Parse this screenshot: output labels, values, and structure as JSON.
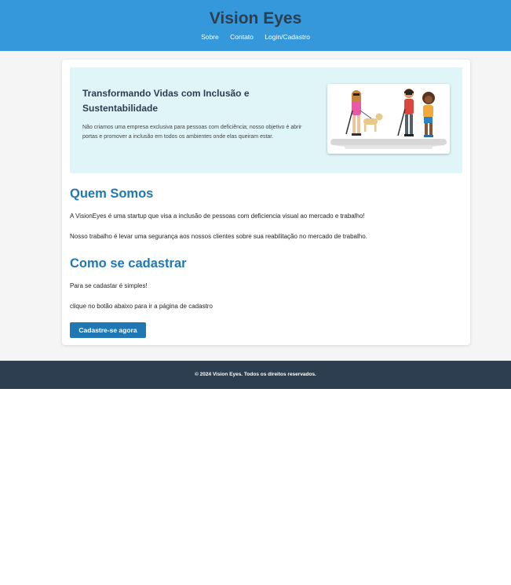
{
  "header": {
    "title": "Vision Eyes",
    "nav": [
      {
        "label": "Sobre"
      },
      {
        "label": "Contato"
      },
      {
        "label": "Login/Cadastro"
      }
    ]
  },
  "hero": {
    "title": "Transformando Vidas com Inclusão e Sustentabilidade",
    "text": "Não criamos uma empresa exclusiva para pessoas com deficiência; nosso objetivo é abrir portas e promover a inclusão em todos os ambientes onde elas queiram estar."
  },
  "about": {
    "title": "Quem Somos",
    "p1": "A VisionEyes é uma startup que visa a inclusão de pessoas com deficiencia visual ao mercado e trabalho!",
    "p2": "Nosso trabalho é levar uma segurança aos nossos clientes sobre sua reabilitação no mercado de trabalho."
  },
  "register": {
    "title": "Como se cadastrar",
    "p1": "Para se cadastar é simples!",
    "p2": "clique no botão abaixo para ir a página de cadastro",
    "button_label": "Cadastre-se agora"
  },
  "footer": {
    "text": "© 2024 Vision Eyes. Todos os direitos reservados."
  }
}
